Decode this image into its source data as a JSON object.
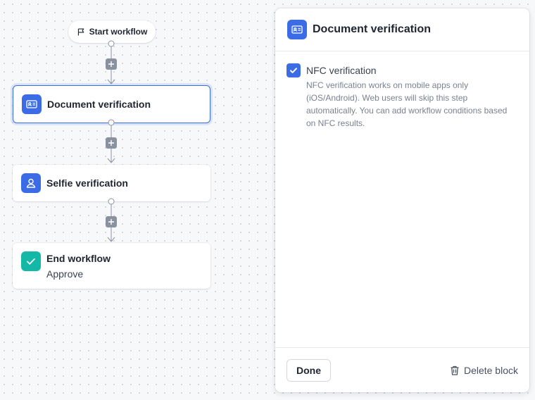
{
  "flow": {
    "start_label": "Start workflow",
    "nodes": [
      {
        "title": "Document verification",
        "icon": "id-card-icon",
        "selected": true
      },
      {
        "title": "Selfie verification",
        "icon": "user-icon",
        "selected": false
      },
      {
        "title": "End workflow",
        "subtitle": "Approve",
        "icon": "check-icon",
        "selected": false
      }
    ]
  },
  "panel": {
    "title": "Document verification",
    "icon": "id-card-icon",
    "option": {
      "label": "NFC verification",
      "checked": true,
      "description": "NFC verification works on mobile apps only (iOS/Android). Web users will skip this step automatically. You can add workflow conditions based on NFC results."
    },
    "done_label": "Done",
    "delete_label": "Delete block"
  },
  "colors": {
    "accent": "#3b6ce6",
    "success": "#14b8a6",
    "connector": "#8a92a0"
  }
}
